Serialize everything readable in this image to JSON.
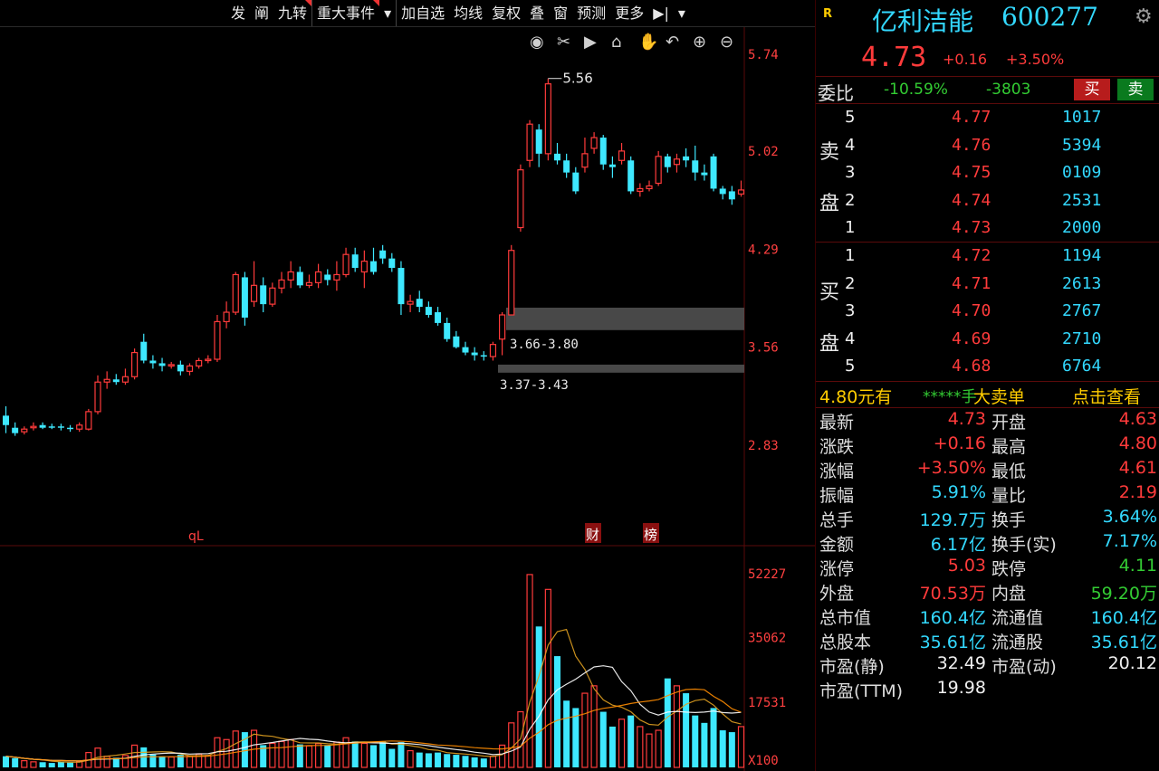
{
  "toolbar": {
    "items": [
      "发",
      "阐",
      "九转",
      "重大事件",
      "▾",
      "加自选",
      "均线",
      "复权",
      "叠",
      "窗",
      "预测",
      "更多",
      "▶|",
      "▾"
    ]
  },
  "chart": {
    "price_ticks": [
      "5.74",
      "5.02",
      "4.29",
      "3.56",
      "2.83"
    ],
    "vol_ticks": [
      "52227",
      "35062",
      "17531",
      "X100"
    ],
    "annotations": {
      "high_label": "5.56",
      "zone1": "3.66-3.80",
      "zone2": "3.37-3.43",
      "bottom_label": "qL",
      "tag_cai": "财",
      "tag_bang": "榜"
    },
    "tool_icons": [
      "eye-icon",
      "scissors-icon",
      "play-icon",
      "lock-icon",
      "hand-icon",
      "undo-icon",
      "zoom-in-icon",
      "zoom-out-icon"
    ]
  },
  "chart_data": {
    "type": "candlestick",
    "price_axis": [
      2.83,
      5.74
    ],
    "candles": [
      {
        "o": 3.05,
        "h": 3.12,
        "l": 2.92,
        "c": 2.98,
        "v": 3000
      },
      {
        "o": 2.96,
        "h": 3.0,
        "l": 2.9,
        "c": 2.92,
        "v": 2500
      },
      {
        "o": 2.93,
        "h": 2.97,
        "l": 2.91,
        "c": 2.95,
        "v": 1800
      },
      {
        "o": 2.96,
        "h": 3.0,
        "l": 2.94,
        "c": 2.97,
        "v": 1500
      },
      {
        "o": 2.98,
        "h": 3.0,
        "l": 2.95,
        "c": 2.96,
        "v": 1400
      },
      {
        "o": 2.97,
        "h": 2.99,
        "l": 2.95,
        "c": 2.96,
        "v": 1200
      },
      {
        "o": 2.97,
        "h": 2.99,
        "l": 2.94,
        "c": 2.96,
        "v": 1500
      },
      {
        "o": 2.96,
        "h": 2.98,
        "l": 2.93,
        "c": 2.95,
        "v": 1300
      },
      {
        "o": 2.95,
        "h": 3.0,
        "l": 2.93,
        "c": 2.98,
        "v": 1600
      },
      {
        "o": 2.95,
        "h": 3.1,
        "l": 2.94,
        "c": 3.08,
        "v": 4000
      },
      {
        "o": 3.08,
        "h": 3.35,
        "l": 3.06,
        "c": 3.3,
        "v": 5200
      },
      {
        "o": 3.3,
        "h": 3.38,
        "l": 3.25,
        "c": 3.32,
        "v": 3000
      },
      {
        "o": 3.32,
        "h": 3.36,
        "l": 3.28,
        "c": 3.3,
        "v": 2600
      },
      {
        "o": 3.3,
        "h": 3.4,
        "l": 3.28,
        "c": 3.34,
        "v": 3200
      },
      {
        "o": 3.34,
        "h": 3.55,
        "l": 3.32,
        "c": 3.52,
        "v": 6000
      },
      {
        "o": 3.6,
        "h": 3.66,
        "l": 3.44,
        "c": 3.46,
        "v": 5400
      },
      {
        "o": 3.46,
        "h": 3.5,
        "l": 3.4,
        "c": 3.44,
        "v": 3500
      },
      {
        "o": 3.44,
        "h": 3.48,
        "l": 3.38,
        "c": 3.42,
        "v": 3000
      },
      {
        "o": 3.42,
        "h": 3.45,
        "l": 3.4,
        "c": 3.43,
        "v": 2800
      },
      {
        "o": 3.43,
        "h": 3.46,
        "l": 3.35,
        "c": 3.38,
        "v": 3400
      },
      {
        "o": 3.38,
        "h": 3.44,
        "l": 3.35,
        "c": 3.42,
        "v": 3000
      },
      {
        "o": 3.42,
        "h": 3.48,
        "l": 3.4,
        "c": 3.46,
        "v": 3600
      },
      {
        "o": 3.46,
        "h": 3.5,
        "l": 3.44,
        "c": 3.47,
        "v": 3200
      },
      {
        "o": 3.47,
        "h": 3.8,
        "l": 3.45,
        "c": 3.75,
        "v": 8000
      },
      {
        "o": 3.75,
        "h": 3.9,
        "l": 3.7,
        "c": 3.82,
        "v": 7500
      },
      {
        "o": 3.82,
        "h": 4.12,
        "l": 3.8,
        "c": 4.1,
        "v": 9800
      },
      {
        "o": 4.08,
        "h": 4.12,
        "l": 3.72,
        "c": 3.78,
        "v": 9500
      },
      {
        "o": 3.9,
        "h": 4.2,
        "l": 3.86,
        "c": 4.02,
        "v": 10000
      },
      {
        "o": 4.02,
        "h": 4.08,
        "l": 3.82,
        "c": 3.88,
        "v": 6000
      },
      {
        "o": 3.88,
        "h": 4.04,
        "l": 3.86,
        "c": 4.0,
        "v": 6500
      },
      {
        "o": 4.0,
        "h": 4.12,
        "l": 3.96,
        "c": 4.06,
        "v": 7000
      },
      {
        "o": 4.06,
        "h": 4.2,
        "l": 4.0,
        "c": 4.12,
        "v": 7500
      },
      {
        "o": 4.12,
        "h": 4.16,
        "l": 4.0,
        "c": 4.02,
        "v": 6200
      },
      {
        "o": 4.02,
        "h": 4.1,
        "l": 4.0,
        "c": 4.04,
        "v": 5800
      },
      {
        "o": 4.04,
        "h": 4.18,
        "l": 4.0,
        "c": 4.12,
        "v": 6400
      },
      {
        "o": 4.1,
        "h": 4.14,
        "l": 4.02,
        "c": 4.06,
        "v": 6000
      },
      {
        "o": 4.06,
        "h": 4.2,
        "l": 3.98,
        "c": 4.1,
        "v": 6800
      },
      {
        "o": 4.1,
        "h": 4.3,
        "l": 4.08,
        "c": 4.25,
        "v": 8000
      },
      {
        "o": 4.25,
        "h": 4.3,
        "l": 4.12,
        "c": 4.15,
        "v": 7000
      },
      {
        "o": 4.12,
        "h": 4.28,
        "l": 4.0,
        "c": 4.2,
        "v": 6500
      },
      {
        "o": 4.2,
        "h": 4.3,
        "l": 4.1,
        "c": 4.12,
        "v": 6000
      },
      {
        "o": 4.28,
        "h": 4.32,
        "l": 4.18,
        "c": 4.22,
        "v": 7000
      },
      {
        "o": 4.22,
        "h": 4.26,
        "l": 4.12,
        "c": 4.15,
        "v": 5000
      },
      {
        "o": 4.15,
        "h": 4.2,
        "l": 3.8,
        "c": 3.88,
        "v": 6800
      },
      {
        "o": 3.88,
        "h": 3.95,
        "l": 3.82,
        "c": 3.9,
        "v": 4500
      },
      {
        "o": 3.92,
        "h": 3.98,
        "l": 3.82,
        "c": 3.86,
        "v": 4000
      },
      {
        "o": 3.86,
        "h": 3.9,
        "l": 3.78,
        "c": 3.8,
        "v": 3800
      },
      {
        "o": 3.82,
        "h": 3.86,
        "l": 3.72,
        "c": 3.74,
        "v": 4000
      },
      {
        "o": 3.74,
        "h": 3.78,
        "l": 3.6,
        "c": 3.62,
        "v": 3600
      },
      {
        "o": 3.64,
        "h": 3.68,
        "l": 3.55,
        "c": 3.56,
        "v": 3400
      },
      {
        "o": 3.56,
        "h": 3.6,
        "l": 3.5,
        "c": 3.52,
        "v": 3100
      },
      {
        "o": 3.52,
        "h": 3.56,
        "l": 3.46,
        "c": 3.5,
        "v": 2700
      },
      {
        "o": 3.5,
        "h": 3.53,
        "l": 3.46,
        "c": 3.49,
        "v": 2400
      },
      {
        "o": 3.49,
        "h": 3.6,
        "l": 3.46,
        "c": 3.58,
        "v": 3000
      },
      {
        "o": 3.62,
        "h": 3.82,
        "l": 3.5,
        "c": 3.8,
        "v": 6000
      },
      {
        "o": 3.8,
        "h": 4.32,
        "l": 3.8,
        "c": 4.28,
        "v": 12000
      },
      {
        "o": 4.45,
        "h": 4.92,
        "l": 4.42,
        "c": 4.88,
        "v": 15000
      },
      {
        "o": 4.95,
        "h": 5.25,
        "l": 4.9,
        "c": 5.22,
        "v": 52000
      },
      {
        "o": 5.18,
        "h": 5.22,
        "l": 4.9,
        "c": 5.0,
        "v": 38000
      },
      {
        "o": 5.0,
        "h": 5.56,
        "l": 4.95,
        "c": 5.52,
        "v": 48000
      },
      {
        "o": 5.0,
        "h": 5.08,
        "l": 4.92,
        "c": 4.95,
        "v": 30000
      },
      {
        "o": 4.95,
        "h": 5.0,
        "l": 4.82,
        "c": 4.86,
        "v": 18000
      },
      {
        "o": 4.86,
        "h": 4.9,
        "l": 4.7,
        "c": 4.72,
        "v": 16000
      },
      {
        "o": 4.9,
        "h": 5.12,
        "l": 4.86,
        "c": 5.0,
        "v": 20000
      },
      {
        "o": 5.04,
        "h": 5.16,
        "l": 5.0,
        "c": 5.12,
        "v": 22000
      },
      {
        "o": 5.12,
        "h": 5.14,
        "l": 4.88,
        "c": 4.92,
        "v": 15000
      },
      {
        "o": 4.92,
        "h": 4.98,
        "l": 4.82,
        "c": 4.9,
        "v": 11000
      },
      {
        "o": 4.95,
        "h": 5.08,
        "l": 4.92,
        "c": 5.02,
        "v": 13000
      },
      {
        "o": 4.95,
        "h": 4.98,
        "l": 4.7,
        "c": 4.72,
        "v": 14000
      },
      {
        "o": 4.72,
        "h": 4.78,
        "l": 4.68,
        "c": 4.74,
        "v": 11000
      },
      {
        "o": 4.74,
        "h": 4.8,
        "l": 4.72,
        "c": 4.76,
        "v": 9000
      },
      {
        "o": 4.78,
        "h": 5.02,
        "l": 4.76,
        "c": 4.98,
        "v": 10000
      },
      {
        "o": 4.98,
        "h": 5.0,
        "l": 4.86,
        "c": 4.9,
        "v": 24000
      },
      {
        "o": 4.92,
        "h": 5.0,
        "l": 4.86,
        "c": 4.96,
        "v": 22000
      },
      {
        "o": 4.98,
        "h": 5.04,
        "l": 4.9,
        "c": 4.95,
        "v": 20000
      },
      {
        "o": 4.95,
        "h": 5.06,
        "l": 4.8,
        "c": 4.86,
        "v": 14000
      },
      {
        "o": 4.86,
        "h": 4.92,
        "l": 4.8,
        "c": 4.84,
        "v": 12000
      },
      {
        "o": 4.98,
        "h": 5.0,
        "l": 4.72,
        "c": 4.74,
        "v": 16000
      },
      {
        "o": 4.74,
        "h": 4.76,
        "l": 4.66,
        "c": 4.7,
        "v": 10000
      },
      {
        "o": 4.72,
        "h": 4.76,
        "l": 4.62,
        "c": 4.66,
        "v": 9500
      },
      {
        "o": 4.7,
        "h": 4.8,
        "l": 4.68,
        "c": 4.73,
        "v": 11000
      }
    ]
  },
  "panel": {
    "badge": "R",
    "name": "亿利洁能",
    "code": "600277",
    "price": "4.73",
    "change": "+0.16",
    "pct": "+3.50%",
    "weibi_label": "委比",
    "weibi_val": "-10.59%",
    "weicha": "-3803",
    "buy_btn": "买",
    "sell_btn": "卖",
    "sell_label_1": "卖",
    "sell_label_2": "盘",
    "buy_label_1": "买",
    "buy_label_2": "盘",
    "asks": [
      {
        "lvl": "5",
        "price": "4.77",
        "vol": "1017"
      },
      {
        "lvl": "4",
        "price": "4.76",
        "vol": "5394"
      },
      {
        "lvl": "3",
        "price": "4.75",
        "vol": "0109"
      },
      {
        "lvl": "2",
        "price": "4.74",
        "vol": "2531"
      },
      {
        "lvl": "1",
        "price": "4.73",
        "vol": "2000"
      }
    ],
    "bids": [
      {
        "lvl": "1",
        "price": "4.72",
        "vol": "1194"
      },
      {
        "lvl": "2",
        "price": "4.71",
        "vol": "2613"
      },
      {
        "lvl": "3",
        "price": "4.70",
        "vol": "2767"
      },
      {
        "lvl": "4",
        "price": "4.69",
        "vol": "2710"
      },
      {
        "lvl": "5",
        "price": "4.68",
        "vol": "6764"
      }
    ],
    "bigorder": {
      "left": "4.80元有",
      "mid": "*****手",
      "right1": "大卖单",
      "right2": "点击查看"
    },
    "stats": [
      {
        "l1": "最新",
        "v1": "4.73",
        "c1": "red",
        "l2": "开盘",
        "v2": "4.63",
        "c2": "red"
      },
      {
        "l1": "涨跌",
        "v1": "+0.16",
        "c1": "red",
        "l2": "最高",
        "v2": "4.80",
        "c2": "red"
      },
      {
        "l1": "涨幅",
        "v1": "+3.50%",
        "c1": "red",
        "l2": "最低",
        "v2": "4.61",
        "c2": "red"
      },
      {
        "l1": "振幅",
        "v1": "5.91%",
        "c1": "cyan",
        "l2": "量比",
        "v2": "2.19",
        "c2": "red"
      },
      {
        "l1": "总手",
        "v1": "129.7万",
        "c1": "cyan",
        "l2": "换手",
        "v2": "3.64%",
        "c2": "cyan"
      },
      {
        "l1": "金额",
        "v1": "6.17亿",
        "c1": "cyan",
        "l2": "换手(实)",
        "v2": "7.17%",
        "c2": "cyan"
      },
      {
        "l1": "涨停",
        "v1": "5.03",
        "c1": "red",
        "l2": "跌停",
        "v2": "4.11",
        "c2": "grn"
      },
      {
        "l1": "外盘",
        "v1": "70.53万",
        "c1": "red",
        "l2": "内盘",
        "v2": "59.20万",
        "c2": "grn"
      },
      {
        "l1": "总市值",
        "v1": "160.4亿",
        "c1": "cyan",
        "l2": "流通值",
        "v2": "160.4亿",
        "c2": "cyan"
      },
      {
        "l1": "总股本",
        "v1": "35.61亿",
        "c1": "cyan",
        "l2": "流通股",
        "v2": "35.61亿",
        "c2": "cyan"
      },
      {
        "l1": "市盈(静)",
        "v1": "32.49",
        "c1": "white",
        "l2": "市盈(动)",
        "v2": "20.12",
        "c2": "white"
      },
      {
        "l1": "市盈(TTM)",
        "v1": "19.98",
        "c1": "white",
        "l2": "",
        "v2": "",
        "c2": "white"
      }
    ]
  },
  "colors": {
    "up": "#ff3b3b",
    "down": "#3ee8ff",
    "ma1": "#ffffff",
    "ma2": "#e0a020",
    "ma3": "#ff8c00"
  }
}
